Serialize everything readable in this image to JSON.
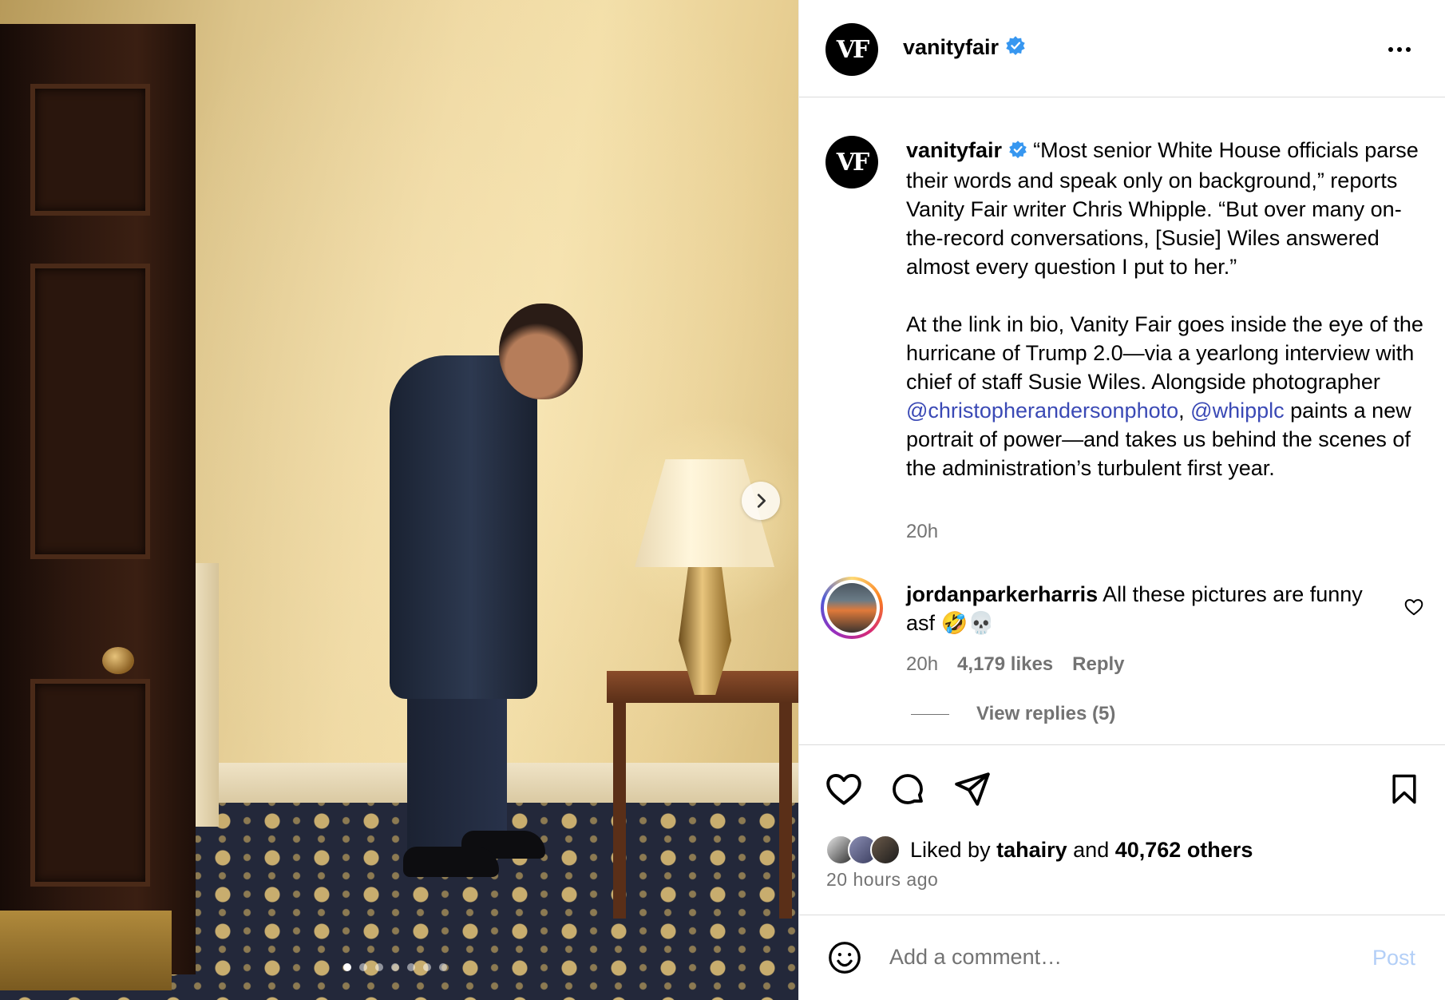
{
  "header": {
    "avatar_text": "VF",
    "username": "vanityfair"
  },
  "caption": {
    "avatar_text": "VF",
    "username": "vanityfair",
    "text_part1": "“Most senior White House officials parse their words and speak only on background,” reports Vanity Fair writer Chris Whipple. “But over many on-the-record conversations, [Susie] Wiles answered almost every question I put to her.”\n\nAt the link in bio, Vanity Fair goes inside the eye of the hurricane of Trump 2.0—via a yearlong interview with chief of staff Susie Wiles. Alongside photographer ",
    "mention1": "@christopherandersonphoto",
    "separator": ", ",
    "mention2": "@whipplc",
    "text_part2": " paints a new portrait of power—and takes us behind the scenes of the administration’s turbulent first year.",
    "time": "20h"
  },
  "comment": {
    "username": "jordanparkerharris",
    "text": "All these pictures are funny asf 🤣💀",
    "time": "20h",
    "likes": "4,179 likes",
    "reply_label": "Reply",
    "view_replies": "View replies (5)"
  },
  "likes": {
    "prefix": "Liked by",
    "user": "tahairy",
    "and": "and",
    "count": "40,762 others",
    "ago": "20 hours ago"
  },
  "comment_box": {
    "placeholder": "Add a comment…",
    "post_label": "Post"
  },
  "carousel": {
    "total": 7,
    "active_index": 0
  },
  "colors": {
    "verified": "#3797f0",
    "mention": "#3a49b5",
    "post_disabled": "#b3cff7",
    "muted": "#737373"
  }
}
